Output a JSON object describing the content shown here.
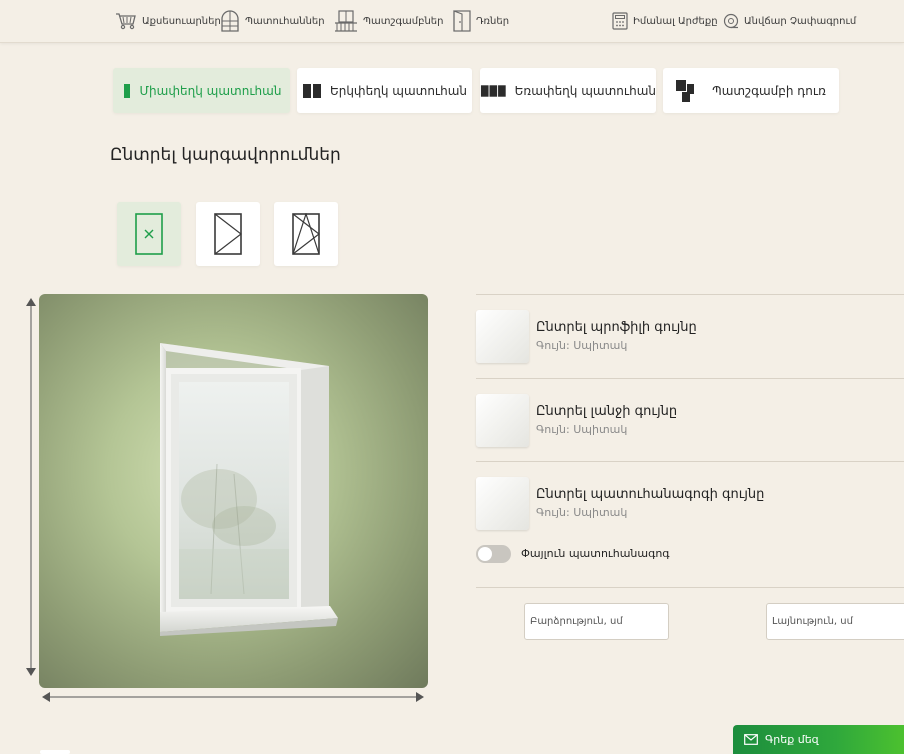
{
  "nav": {
    "accessories": "Աքսեսուարներ",
    "windows": "Պատուհաններ",
    "balconies": "Պատշգամբներ",
    "doors": "Դռներ",
    "price": "Իմանալ Արժեքը",
    "measure": "Անվճար Չափագրում"
  },
  "tabs": {
    "single": "Միափեղկ պատուհան",
    "double": "Երկփեղկ պատուհան",
    "triple": "Եռափեղկ պատուհան",
    "balcony_door": "Պատշգամբի դուռ"
  },
  "settings_title": "Ընտրել կարգավորումներ",
  "options": {
    "profile": {
      "title": "Ընտրել պրոֆիլի գույնը",
      "color": "Գույն: Սպիտակ"
    },
    "hinge": {
      "title": "Ընտրել լանջի գույնը",
      "color": "Գույն: Սպիտակ"
    },
    "sill": {
      "title": "Ընտրել պատուհանագոգի գույնը",
      "color": "Գույն: Սպիտակ"
    }
  },
  "toggle": {
    "label": "Փայլուն պատուհանագոգ",
    "on": false
  },
  "inputs": {
    "height_placeholder": "Բարձրություն, սմ",
    "width_placeholder": "Լայնություն, սմ",
    "height_value": "",
    "width_value": ""
  },
  "write_button": "Գրեք մեզ",
  "colors": {
    "accent": "#1e9e4a",
    "background": "#f4efe6",
    "active_tab": "#e3ecdc"
  },
  "icons": [
    "cart-icon",
    "window-arch-icon",
    "balcony-icon",
    "door-icon",
    "calculator-icon",
    "tape-measure-icon",
    "mail-icon",
    "close-icon"
  ]
}
